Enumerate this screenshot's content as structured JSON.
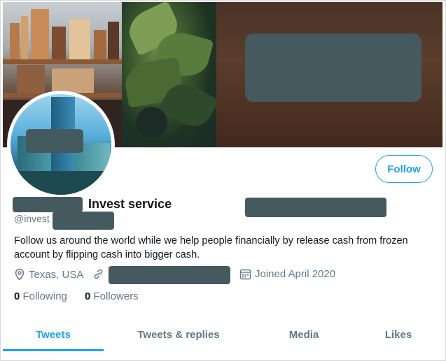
{
  "profile": {
    "name_suffix": "Invest service",
    "handle_prefix": "@invest",
    "bio": "Follow us around the world while we help people financially by release cash from frozen account by flipping cash into bigger cash.",
    "location": "Texas, USA",
    "joined": "Joined April 2020",
    "follow_label": "Follow"
  },
  "stats": {
    "following_count": "0",
    "following_label": "Following",
    "followers_count": "0",
    "followers_label": "Followers"
  },
  "tabs": [
    {
      "label": "Tweets",
      "active": true
    },
    {
      "label": "Tweets & replies",
      "active": false
    },
    {
      "label": "Media",
      "active": false
    },
    {
      "label": "Likes",
      "active": false
    }
  ],
  "icons": {
    "location": "location-pin-icon",
    "link": "link-icon",
    "calendar": "calendar-icon"
  },
  "colors": {
    "accent": "#1da1f2",
    "redaction": "#455a5e",
    "secondary_text": "#657786"
  }
}
